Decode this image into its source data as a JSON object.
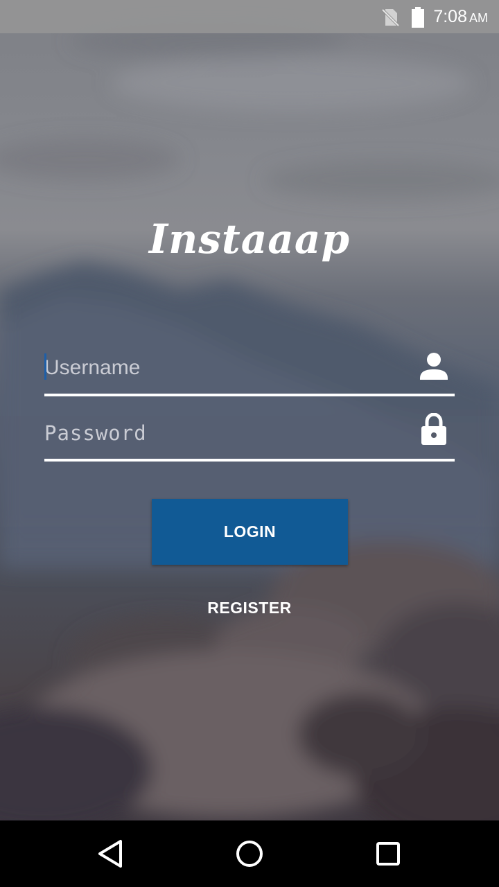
{
  "status_bar": {
    "time": "7:08",
    "ampm": "AM",
    "icons": [
      "no-sim-icon",
      "battery-icon"
    ]
  },
  "app": {
    "logo_text": "Instaaap"
  },
  "login_form": {
    "username_placeholder": "Username",
    "password_placeholder": "Password",
    "username_icon": "person-icon",
    "password_icon": "lock-icon",
    "login_label": "LOGIN",
    "register_label": "REGISTER"
  },
  "nav_bar": {
    "icons": [
      "back-icon",
      "home-icon",
      "recents-icon"
    ]
  },
  "colors": {
    "accent": "#115a95",
    "cursor": "#1e5fa8",
    "text": "#ffffff"
  }
}
